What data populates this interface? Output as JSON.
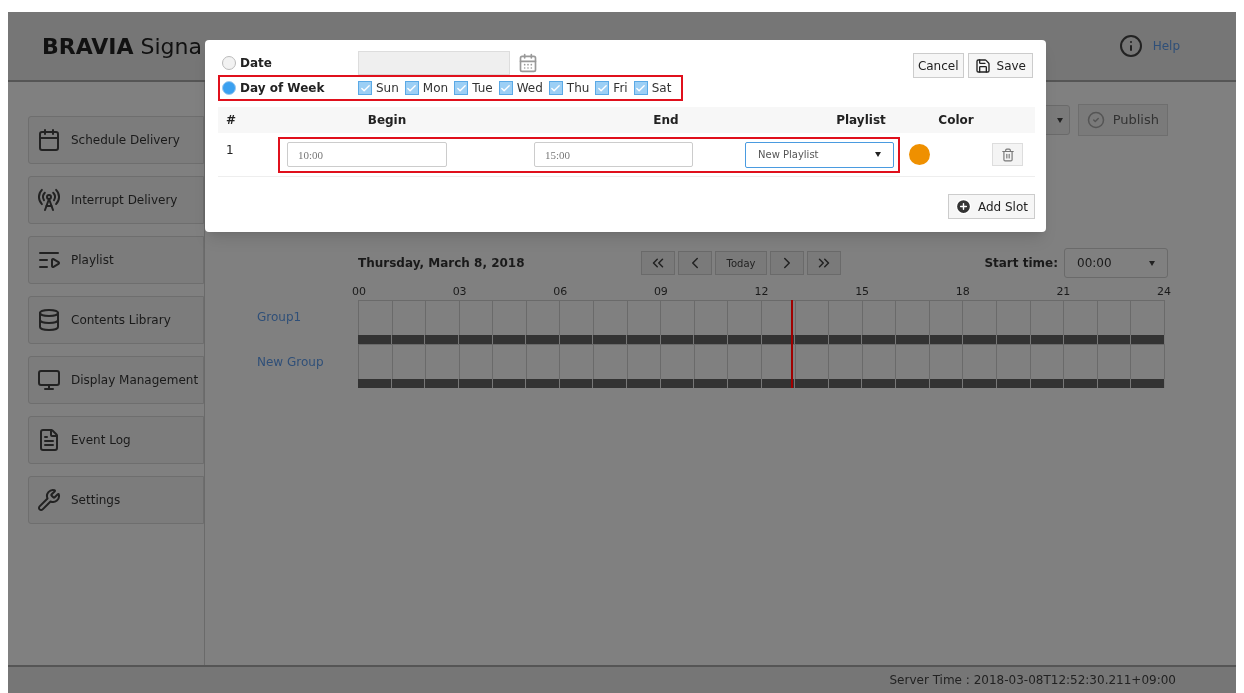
{
  "header": {
    "brand": "BRAVIA",
    "product": "Signa",
    "help": "Help"
  },
  "sidebar": {
    "items": [
      {
        "label": "Schedule Delivery"
      },
      {
        "label": "Interrupt Delivery"
      },
      {
        "label": "Playlist"
      },
      {
        "label": "Contents Library"
      },
      {
        "label": "Display Management"
      },
      {
        "label": "Event Log"
      },
      {
        "label": "Settings"
      }
    ]
  },
  "toolbar": {
    "publish": "Publish"
  },
  "calendar": {
    "date": "Thursday, March 8, 2018",
    "today": "Today",
    "start_time_label": "Start time:",
    "start_time": "00:00",
    "hours": [
      "00",
      "03",
      "06",
      "09",
      "12",
      "15",
      "18",
      "21",
      "24"
    ],
    "groups": [
      "Group1",
      "New Group"
    ],
    "now_marker": {
      "level": 0.536
    }
  },
  "status_bar": {
    "server_time": "Server Time : 2018-03-08T12:52:30.211+09:00"
  },
  "dialog": {
    "date_option": {
      "label": "Date",
      "selected": false
    },
    "week_option": {
      "label": "Day of Week",
      "selected": true
    },
    "days": [
      {
        "label": "Sun",
        "checked": true
      },
      {
        "label": "Mon",
        "checked": true
      },
      {
        "label": "Tue",
        "checked": true
      },
      {
        "label": "Wed",
        "checked": true
      },
      {
        "label": "Thu",
        "checked": true
      },
      {
        "label": "Fri",
        "checked": true
      },
      {
        "label": "Sat",
        "checked": true
      }
    ],
    "cancel": "Cancel",
    "save": "Save",
    "columns": [
      "#",
      "Begin",
      "End",
      "Playlist",
      "Color"
    ],
    "rows": [
      {
        "index": "1",
        "begin": "10:00",
        "end": "15:00",
        "playlist": "New Playlist",
        "color": "#ef9000"
      }
    ],
    "add_slot": "Add Slot"
  }
}
